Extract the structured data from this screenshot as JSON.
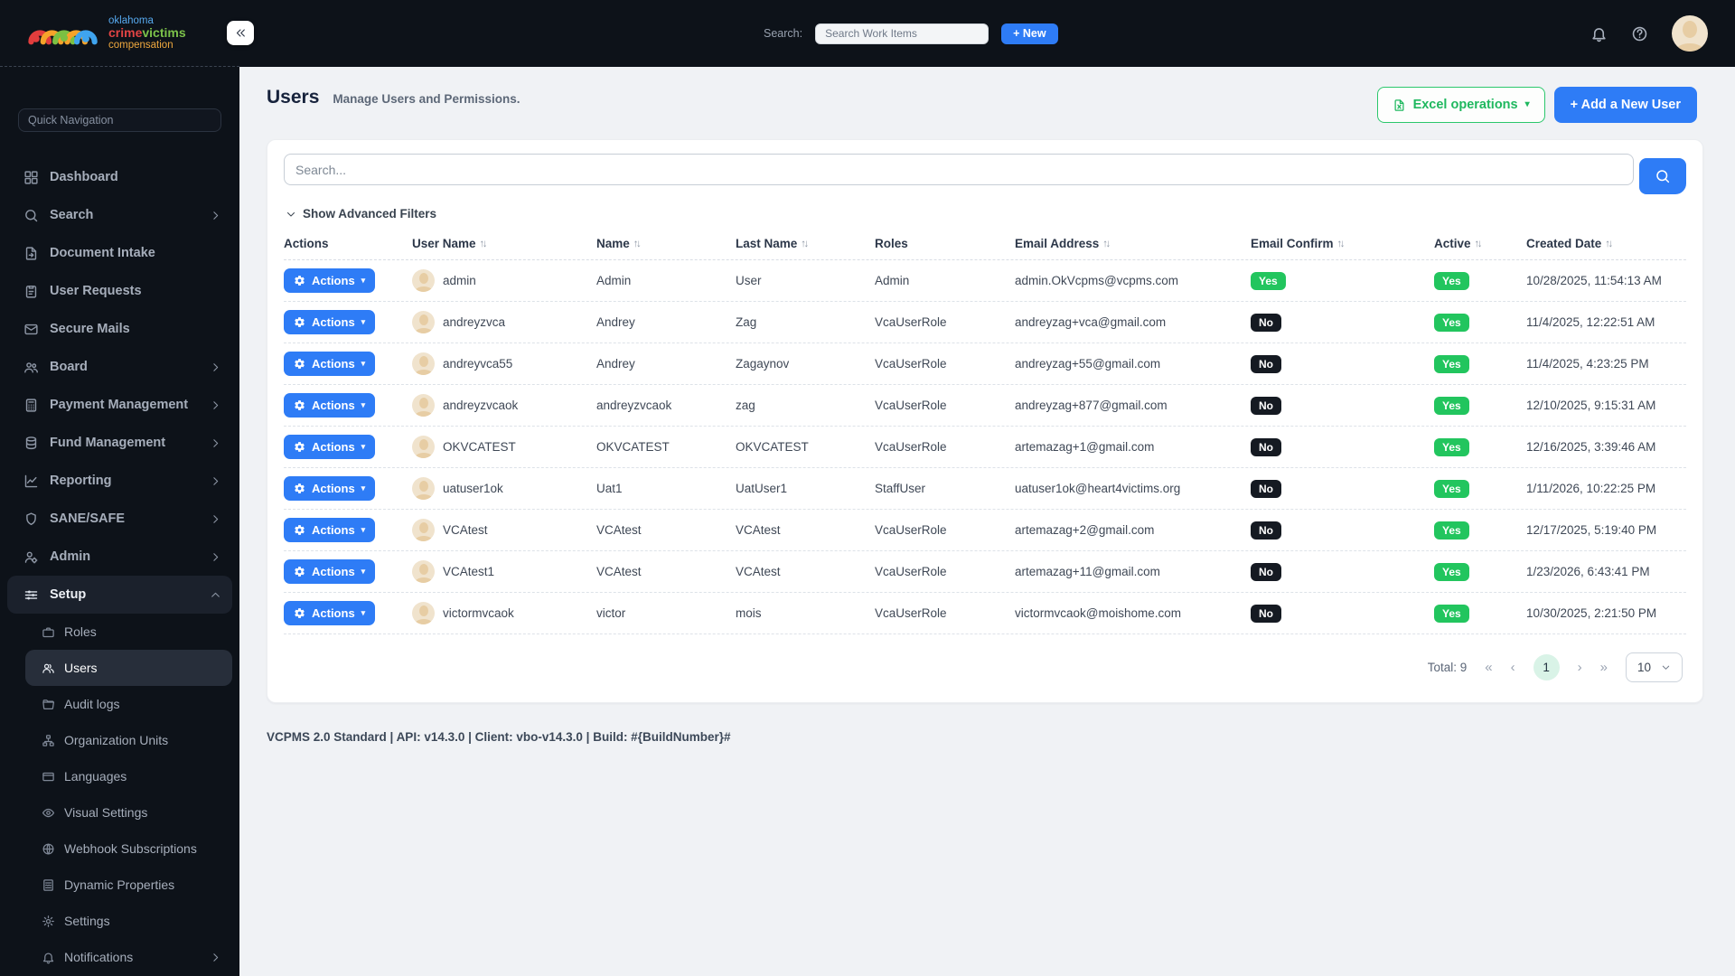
{
  "brand": {
    "line1": "oklahoma",
    "crime": "crime",
    "victims": "victims",
    "line3": "compensation"
  },
  "header": {
    "search_label": "Search:",
    "search_placeholder": "Search Work Items",
    "new_button": "+ New"
  },
  "sidebar": {
    "quick_nav_placeholder": "Quick Navigation",
    "items": [
      {
        "label": "Dashboard",
        "icon": "dashboard-icon"
      },
      {
        "label": "Search",
        "icon": "search-icon",
        "chevron": "right"
      },
      {
        "label": "Document Intake",
        "icon": "document-intake-icon"
      },
      {
        "label": "User Requests",
        "icon": "user-requests-icon"
      },
      {
        "label": "Secure Mails",
        "icon": "secure-mails-icon"
      },
      {
        "label": "Board",
        "icon": "board-icon",
        "chevron": "right"
      },
      {
        "label": "Payment Management",
        "icon": "payment-icon",
        "chevron": "right"
      },
      {
        "label": "Fund Management",
        "icon": "fund-icon",
        "chevron": "right"
      },
      {
        "label": "Reporting",
        "icon": "reporting-icon",
        "chevron": "right"
      },
      {
        "label": "SANE/SAFE",
        "icon": "shield-icon",
        "chevron": "right"
      },
      {
        "label": "Admin",
        "icon": "admin-icon",
        "chevron": "right"
      },
      {
        "label": "Setup",
        "icon": "setup-icon",
        "chevron": "up",
        "active": true
      },
      {
        "label": "Roles",
        "icon": "roles-icon",
        "sub": true
      },
      {
        "label": "Users",
        "icon": "users-icon",
        "sub": true,
        "active": true
      },
      {
        "label": "Audit logs",
        "icon": "audit-logs-icon",
        "sub": true
      },
      {
        "label": "Organization Units",
        "icon": "org-units-icon",
        "sub": true
      },
      {
        "label": "Languages",
        "icon": "languages-icon",
        "sub": true
      },
      {
        "label": "Visual Settings",
        "icon": "visual-settings-icon",
        "sub": true
      },
      {
        "label": "Webhook Subscriptions",
        "icon": "webhooks-icon",
        "sub": true
      },
      {
        "label": "Dynamic Properties",
        "icon": "dynamic-properties-icon",
        "sub": true
      },
      {
        "label": "Settings",
        "icon": "settings-icon",
        "sub": true
      },
      {
        "label": "Notifications",
        "icon": "notifications-icon",
        "sub": true,
        "chevron": "right"
      }
    ]
  },
  "page": {
    "title": "Users",
    "subtitle": "Manage Users and Permissions.",
    "excel_button": "Excel operations",
    "add_button": "+ Add a New User",
    "table_search_placeholder": "Search...",
    "filters_toggle": "Show Advanced Filters"
  },
  "table": {
    "actions_button": "Actions",
    "columns": [
      {
        "label": "Actions",
        "sortable": false
      },
      {
        "label": "User Name",
        "sortable": true
      },
      {
        "label": "Name",
        "sortable": true
      },
      {
        "label": "Last Name",
        "sortable": true
      },
      {
        "label": "Roles",
        "sortable": false
      },
      {
        "label": "Email Address",
        "sortable": true
      },
      {
        "label": "Email Confirm",
        "sortable": true
      },
      {
        "label": "Active",
        "sortable": true
      },
      {
        "label": "Created Date",
        "sortable": true
      }
    ],
    "rows": [
      {
        "user_name": "admin",
        "name": "Admin",
        "last_name": "User",
        "role": "Admin",
        "email": "admin.OkVcpms@vcpms.com",
        "email_confirm": "Yes",
        "active": "Yes",
        "created": "10/28/2025, 11:54:13 AM"
      },
      {
        "user_name": "andreyzvca",
        "name": "Andrey",
        "last_name": "Zag",
        "role": "VcaUserRole",
        "email": "andreyzag+vca@gmail.com",
        "email_confirm": "No",
        "active": "Yes",
        "created": "11/4/2025, 12:22:51 AM"
      },
      {
        "user_name": "andreyvca55",
        "name": "Andrey",
        "last_name": "Zagaynov",
        "role": "VcaUserRole",
        "email": "andreyzag+55@gmail.com",
        "email_confirm": "No",
        "active": "Yes",
        "created": "11/4/2025, 4:23:25 PM"
      },
      {
        "user_name": "andreyzvcaok",
        "name": "andreyzvcaok",
        "last_name": "zag",
        "role": "VcaUserRole",
        "email": "andreyzag+877@gmail.com",
        "email_confirm": "No",
        "active": "Yes",
        "created": "12/10/2025, 9:15:31 AM"
      },
      {
        "user_name": "OKVCATEST",
        "name": "OKVCATEST",
        "last_name": "OKVCATEST",
        "role": "VcaUserRole",
        "email": "artemazag+1@gmail.com",
        "email_confirm": "No",
        "active": "Yes",
        "created": "12/16/2025, 3:39:46 AM"
      },
      {
        "user_name": "uatuser1ok",
        "name": "Uat1",
        "last_name": "UatUser1",
        "role": "StaffUser",
        "email": "uatuser1ok@heart4victims.org",
        "email_confirm": "No",
        "active": "Yes",
        "created": "1/11/2026, 10:22:25 PM"
      },
      {
        "user_name": "VCAtest",
        "name": "VCAtest",
        "last_name": "VCAtest",
        "role": "VcaUserRole",
        "email": "artemazag+2@gmail.com",
        "email_confirm": "No",
        "active": "Yes",
        "created": "12/17/2025, 5:19:40 PM"
      },
      {
        "user_name": "VCAtest1",
        "name": "VCAtest",
        "last_name": "VCAtest",
        "role": "VcaUserRole",
        "email": "artemazag+11@gmail.com",
        "email_confirm": "No",
        "active": "Yes",
        "created": "1/23/2026, 6:43:41 PM"
      },
      {
        "user_name": "victormvcaok",
        "name": "victor",
        "last_name": "mois",
        "role": "VcaUserRole",
        "email": "victormvcaok@moishome.com",
        "email_confirm": "No",
        "active": "Yes",
        "created": "10/30/2025, 2:21:50 PM"
      }
    ]
  },
  "pagination": {
    "total": "Total: 9",
    "first": "«",
    "prev": "‹",
    "page": "1",
    "next": "›",
    "last": "»",
    "page_size": "10"
  },
  "footer": {
    "text": "VCPMS 2.0 Standard | API: v14.3.0 | Client: vbo-v14.3.0 | Build: #{BuildNumber}#"
  },
  "colors": {
    "accent_blue": "#2e7cf6",
    "success_green": "#22c55e",
    "badge_no_dark": "#151a22",
    "excel_green": "#2bc76c",
    "sidebar_bg": "#0d1219",
    "page_bg": "#f0f2f5"
  }
}
